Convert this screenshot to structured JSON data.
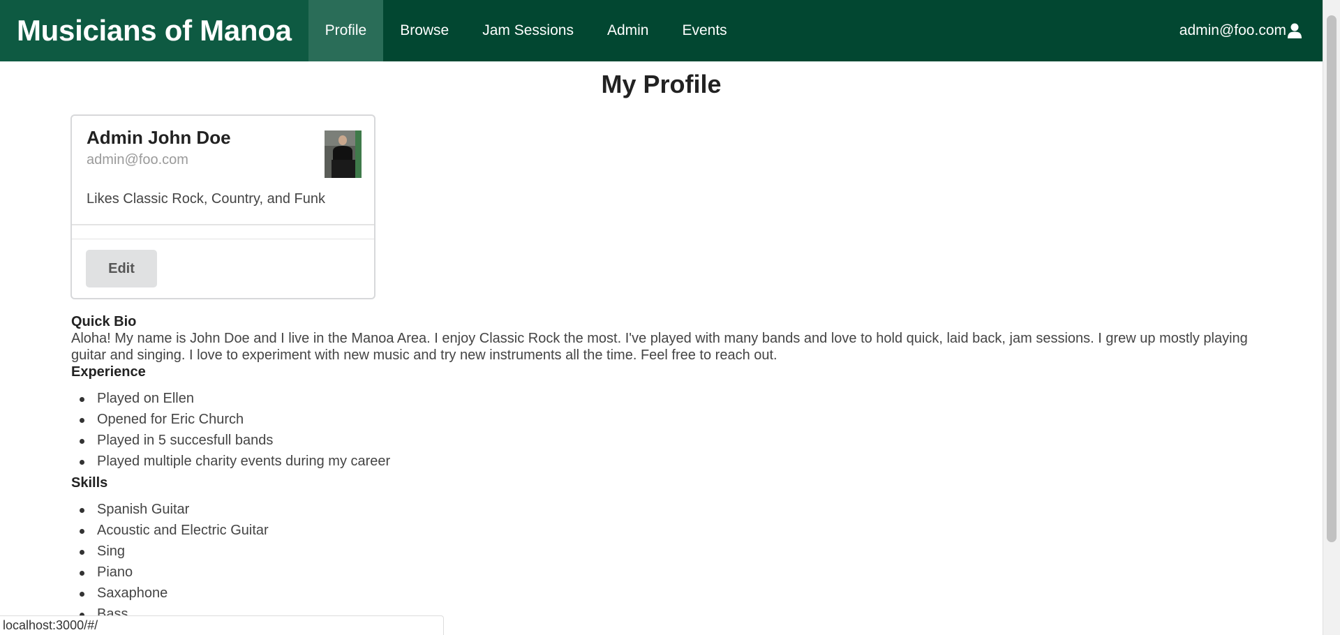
{
  "navbar": {
    "brand": "Musicians of Manoa",
    "items": [
      {
        "label": "Profile",
        "active": true
      },
      {
        "label": "Browse"
      },
      {
        "label": "Jam Sessions"
      },
      {
        "label": "Admin"
      },
      {
        "label": "Events"
      }
    ],
    "user_email": "admin@foo.com",
    "user_icon": "user-icon"
  },
  "page_title": "My Profile",
  "profile_card": {
    "name": "Admin John Doe",
    "email": "admin@foo.com",
    "description": "Likes Classic Rock, Country, and Funk",
    "edit_label": "Edit"
  },
  "bio": {
    "title": "Quick Bio",
    "text": "Aloha! My name is John Doe and I live in the Manoa Area. I enjoy Classic Rock the most. I've played with many bands and love to hold quick, laid back, jam sessions. I grew up mostly playing guitar and singing. I love to experiment with new music and try new instruments all the time. Feel free to reach out."
  },
  "experience": {
    "title": "Experience",
    "items": [
      "Played on Ellen",
      "Opened for Eric Church",
      "Played in 5 succesfull bands",
      "Played multiple charity events during my career"
    ]
  },
  "skills": {
    "title": "Skills",
    "items": [
      "Spanish Guitar",
      "Acoustic and Electric Guitar",
      "Sing",
      "Piano",
      "Saxaphone",
      "Bass"
    ]
  },
  "status_bar": {
    "url": "localhost:3000/#/"
  },
  "colors": {
    "navbar": "#024731",
    "brand_bg": "#0e5a42",
    "active_tab": "#2a6d58"
  }
}
